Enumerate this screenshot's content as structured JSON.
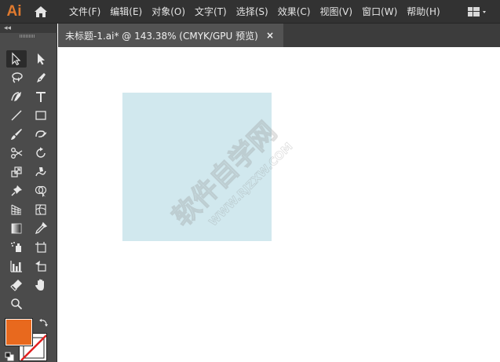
{
  "app": {
    "logo": "Ai",
    "logo_color": "#e07a2e"
  },
  "menubar": {
    "items": [
      {
        "label": "文件(F)"
      },
      {
        "label": "编辑(E)"
      },
      {
        "label": "对象(O)"
      },
      {
        "label": "文字(T)"
      },
      {
        "label": "选择(S)"
      },
      {
        "label": "效果(C)"
      },
      {
        "label": "视图(V)"
      },
      {
        "label": "窗口(W)"
      },
      {
        "label": "帮助(H)"
      }
    ],
    "home_icon": "home-icon",
    "workspace_icon": "workspace-switcher-icon"
  },
  "toolbar": {
    "collapse": "◂◂",
    "tools": [
      {
        "name": "selection-tool",
        "active": true
      },
      {
        "name": "direct-selection-tool"
      },
      {
        "name": "lasso-tool"
      },
      {
        "name": "pen-tool"
      },
      {
        "name": "curvature-tool"
      },
      {
        "name": "type-tool",
        "glyph": "T"
      },
      {
        "name": "line-segment-tool"
      },
      {
        "name": "rectangle-tool"
      },
      {
        "name": "paintbrush-tool"
      },
      {
        "name": "shaper-tool"
      },
      {
        "name": "scissors-tool"
      },
      {
        "name": "rotate-tool"
      },
      {
        "name": "scale-tool"
      },
      {
        "name": "warp-tool"
      },
      {
        "name": "puppet-warp-tool"
      },
      {
        "name": "shape-builder-tool"
      },
      {
        "name": "perspective-grid-tool"
      },
      {
        "name": "mesh-tool"
      },
      {
        "name": "gradient-tool"
      },
      {
        "name": "eyedropper-tool"
      },
      {
        "name": "symbol-sprayer-tool"
      },
      {
        "name": "artboard-tool"
      },
      {
        "name": "graph-tool"
      },
      {
        "name": "slice-tool"
      },
      {
        "name": "eraser-tool"
      },
      {
        "name": "hand-tool"
      },
      {
        "name": "zoom-tool"
      }
    ],
    "fill_color": "#e8691e",
    "stroke_color": "none"
  },
  "document": {
    "tab_title": "未标题-1.ai* @ 143.38% (CMYK/GPU 预览)",
    "close_label": "×"
  },
  "canvas": {
    "rect_color": "#d1e8ee",
    "watermark_main": "软件自学网",
    "watermark_sub": "WWW.RJZXW.COM"
  }
}
